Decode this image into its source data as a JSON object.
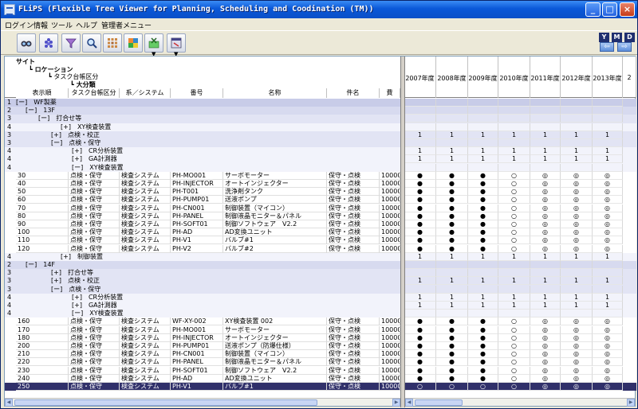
{
  "window": {
    "title": "FLiPS (Flexible Tree Viewer for Planning, Scheduling and Coodination (TM))"
  },
  "menu": [
    "ログイン情報",
    "ツール",
    "ヘルプ",
    "管理者メニュー"
  ],
  "toolbar": {
    "buttons": [
      "binoculars-icon",
      "grapes-icon",
      "filter-icon",
      "magnifier-icon",
      "grid-dots-icon",
      "color-blocks-icon",
      "chart-export-icon",
      "window-export-icon"
    ],
    "right_labels": [
      "Y",
      "M",
      "D"
    ],
    "nav_prev": "⇦",
    "nav_next": "⇨"
  },
  "colors": {
    "accent": "#0a58d8",
    "selection": "#30306a"
  },
  "header": {
    "tree_levels": [
      "サイト",
      "ロケーション",
      "タスク台帳区分",
      "大分類"
    ],
    "columns": [
      "表示順",
      "タスク台帳区分",
      "系／システム",
      "番号",
      "名称",
      "件名",
      "費"
    ],
    "years": [
      "2007年度",
      "2008年度",
      "2009年度",
      "2010年度",
      "2011年度",
      "2012年度",
      "2013年度",
      "2"
    ]
  },
  "rows": [
    {
      "lvl": "1",
      "tree": "[ー]　WF製薬",
      "cls": "g1",
      "ind": 8
    },
    {
      "lvl": "2",
      "tree": "[ー]　13F",
      "cls": "g2",
      "ind": 20
    },
    {
      "lvl": "3",
      "tree": "[ー]　打合せ等",
      "cls": "g3",
      "ind": 36
    },
    {
      "lvl": "4",
      "tree": "[+]　XY検査装置",
      "cls": "g4",
      "ind": 64
    },
    {
      "lvl": "3",
      "tree": "[+]　点検・校正",
      "cls": "g3",
      "ind": 52,
      "years": [
        "1",
        "1",
        "1",
        "1",
        "1",
        "1",
        "1"
      ]
    },
    {
      "lvl": "3",
      "tree": "[ー]　点検・保守",
      "cls": "g3",
      "ind": 52
    },
    {
      "lvl": "4",
      "tree": "[+]　CR分析装置",
      "cls": "g4",
      "ind": 78,
      "years": [
        "1",
        "1",
        "1",
        "1",
        "1",
        "1",
        "1"
      ]
    },
    {
      "lvl": "4",
      "tree": "[+]　GA計測器",
      "cls": "g4",
      "ind": 78,
      "years": [
        "1",
        "1",
        "1",
        "1",
        "1",
        "1",
        "1"
      ]
    },
    {
      "lvl": "4",
      "tree": "[ー]　XY検査装置",
      "cls": "g4",
      "ind": 78
    },
    {
      "cls": "item",
      "order": "30",
      "task": "点検・保守",
      "sys": "検査システム",
      "num": "PH-MO001",
      "name": "サーボモーター",
      "subject": "保守・点検",
      "cost": "10000",
      "years": [
        "●",
        "●",
        "●",
        "○",
        "◎",
        "◎",
        "◎"
      ]
    },
    {
      "cls": "item",
      "order": "40",
      "task": "点検・保守",
      "sys": "検査システム",
      "num": "PH-INJECTOR",
      "name": "オートインジェクター",
      "subject": "保守・点検",
      "cost": "10000",
      "years": [
        "●",
        "●",
        "●",
        "○",
        "◎",
        "◎",
        "◎"
      ]
    },
    {
      "cls": "item",
      "order": "50",
      "task": "点検・保守",
      "sys": "検査システム",
      "num": "PH-T001",
      "name": "洗浄剤タンク",
      "subject": "保守・点検",
      "cost": "10000",
      "years": [
        "●",
        "●",
        "●",
        "○",
        "◎",
        "◎",
        "◎"
      ]
    },
    {
      "cls": "item",
      "order": "60",
      "task": "点検・保守",
      "sys": "検査システム",
      "num": "PH-PUMP01",
      "name": "送液ポンプ",
      "subject": "保守・点検",
      "cost": "10000",
      "years": [
        "●",
        "●",
        "●",
        "○",
        "◎",
        "◎",
        "◎"
      ]
    },
    {
      "cls": "item",
      "order": "70",
      "task": "点検・保守",
      "sys": "検査システム",
      "num": "PH-CN001",
      "name": "制御装置（マイコン）",
      "subject": "保守・点検",
      "cost": "10000",
      "years": [
        "●",
        "●",
        "●",
        "○",
        "◎",
        "◎",
        "◎"
      ]
    },
    {
      "cls": "item",
      "order": "80",
      "task": "点検・保守",
      "sys": "検査システム",
      "num": "PH-PANEL",
      "name": "制御液晶モニター＆パネル",
      "subject": "保守・点検",
      "cost": "10000",
      "years": [
        "●",
        "●",
        "●",
        "○",
        "◎",
        "◎",
        "◎"
      ]
    },
    {
      "cls": "item",
      "order": "90",
      "task": "点検・保守",
      "sys": "検査システム",
      "num": "PH-SOFT01",
      "name": "制御ソフトウェア　V2.2",
      "subject": "保守・点検",
      "cost": "10000",
      "years": [
        "●",
        "●",
        "●",
        "○",
        "◎",
        "◎",
        "◎"
      ]
    },
    {
      "cls": "item",
      "order": "100",
      "task": "点検・保守",
      "sys": "検査システム",
      "num": "PH-AD",
      "name": "AD変換ユニット",
      "subject": "保守・点検",
      "cost": "10000",
      "years": [
        "●",
        "●",
        "●",
        "○",
        "◎",
        "◎",
        "◎"
      ]
    },
    {
      "cls": "item",
      "order": "110",
      "task": "点検・保守",
      "sys": "検査システム",
      "num": "PH-V1",
      "name": "バルブ#1",
      "subject": "保守・点検",
      "cost": "10000",
      "years": [
        "●",
        "●",
        "●",
        "○",
        "◎",
        "◎",
        "◎"
      ]
    },
    {
      "cls": "item",
      "order": "120",
      "task": "点検・保守",
      "sys": "検査システム",
      "num": "PH-V2",
      "name": "バルブ#2",
      "subject": "保守・点検",
      "cost": "10000",
      "years": [
        "●",
        "●",
        "●",
        "○",
        "◎",
        "◎",
        "◎"
      ]
    },
    {
      "lvl": "4",
      "tree": "[+]　制御装置",
      "cls": "g4",
      "ind": 64,
      "years": [
        "1",
        "1",
        "1",
        "1",
        "1",
        "1",
        "1"
      ]
    },
    {
      "lvl": "2",
      "tree": "[ー]　14F",
      "cls": "g2",
      "ind": 20
    },
    {
      "lvl": "3",
      "tree": "[+]　打合せ等",
      "cls": "g3",
      "ind": 52
    },
    {
      "lvl": "3",
      "tree": "[+]　点検・校正",
      "cls": "g3",
      "ind": 52,
      "years": [
        "1",
        "1",
        "1",
        "1",
        "1",
        "1",
        "1"
      ]
    },
    {
      "lvl": "3",
      "tree": "[ー]　点検・保守",
      "cls": "g3",
      "ind": 52
    },
    {
      "lvl": "4",
      "tree": "[+]　CR分析装置",
      "cls": "g4",
      "ind": 78,
      "years": [
        "1",
        "1",
        "1",
        "1",
        "1",
        "1",
        "1"
      ]
    },
    {
      "lvl": "4",
      "tree": "[+]　GA計測器",
      "cls": "g4",
      "ind": 78,
      "years": [
        "1",
        "1",
        "1",
        "1",
        "1",
        "1",
        "1"
      ]
    },
    {
      "lvl": "4",
      "tree": "[ー]　XY検査装置",
      "cls": "g4",
      "ind": 78
    },
    {
      "cls": "item",
      "order": "160",
      "task": "点検・保守",
      "sys": "検査システム",
      "num": "WF-XY-002",
      "name": "XY検査装置 002",
      "subject": "保守・点検",
      "cost": "10000",
      "years": [
        "●",
        "●",
        "●",
        "○",
        "◎",
        "◎",
        "◎"
      ]
    },
    {
      "cls": "item",
      "order": "170",
      "task": "点検・保守",
      "sys": "検査システム",
      "num": "PH-MO001",
      "name": "サーボモーター",
      "subject": "保守・点検",
      "cost": "10000",
      "years": [
        "●",
        "●",
        "●",
        "○",
        "◎",
        "◎",
        "◎"
      ]
    },
    {
      "cls": "item",
      "order": "180",
      "task": "点検・保守",
      "sys": "検査システム",
      "num": "PH-INJECTOR",
      "name": "オートインジェクター",
      "subject": "保守・点検",
      "cost": "10000",
      "years": [
        "●",
        "●",
        "●",
        "○",
        "◎",
        "◎",
        "◎"
      ]
    },
    {
      "cls": "item",
      "order": "200",
      "task": "点検・保守",
      "sys": "検査システム",
      "num": "PH-PUMP01",
      "name": "送液ポンプ（防爆仕様）",
      "subject": "保守・点検",
      "cost": "10000",
      "years": [
        "●",
        "●",
        "●",
        "○",
        "◎",
        "◎",
        "◎"
      ]
    },
    {
      "cls": "item",
      "order": "210",
      "task": "点検・保守",
      "sys": "検査システム",
      "num": "PH-CN001",
      "name": "制御装置（マイコン）",
      "subject": "保守・点検",
      "cost": "10000",
      "years": [
        "●",
        "●",
        "●",
        "○",
        "◎",
        "◎",
        "◎"
      ]
    },
    {
      "cls": "item",
      "order": "220",
      "task": "点検・保守",
      "sys": "検査システム",
      "num": "PH-PANEL",
      "name": "制御液晶モニター＆パネル",
      "subject": "保守・点検",
      "cost": "10000",
      "years": [
        "●",
        "●",
        "●",
        "○",
        "◎",
        "◎",
        "◎"
      ]
    },
    {
      "cls": "item",
      "order": "230",
      "task": "点検・保守",
      "sys": "検査システム",
      "num": "PH-SOFT01",
      "name": "制御ソフトウェア　V2.2",
      "subject": "保守・点検",
      "cost": "10000",
      "years": [
        "●",
        "●",
        "●",
        "○",
        "◎",
        "◎",
        "◎"
      ]
    },
    {
      "cls": "item",
      "order": "240",
      "task": "点検・保守",
      "sys": "検査システム",
      "num": "PH-AD",
      "name": "AD変換ユニット",
      "subject": "保守・点検",
      "cost": "10000",
      "years": [
        "●",
        "●",
        "●",
        "○",
        "◎",
        "◎",
        "◎"
      ]
    },
    {
      "cls": "sel",
      "order": "250",
      "task": "点検・保守",
      "sys": "検査システム",
      "num": "PH-V1",
      "name": "バルブ#1",
      "subject": "保守・点検",
      "cost": "10000",
      "years": [
        "○",
        "○",
        "○",
        "○",
        "◎",
        "◎",
        "◎"
      ]
    }
  ]
}
